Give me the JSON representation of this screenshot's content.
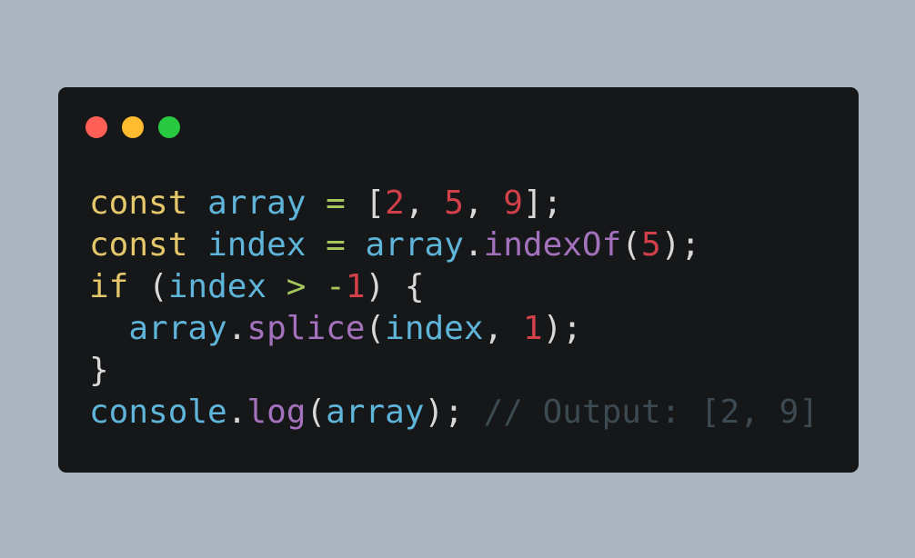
{
  "colors": {
    "background": "#abb5bf",
    "window": "#161719",
    "dot_close": "#ff5f57",
    "dot_minimize": "#febc2e",
    "dot_maximize": "#28c840",
    "keyword": "#e5c76b",
    "identifier": "#5fb4d9",
    "operator": "#a4c55b",
    "number": "#d2404a",
    "function": "#a472bd",
    "punctuation": "#d8d8d8",
    "comment": "#3c4a52"
  },
  "code": {
    "language": "javascript",
    "lines": [
      {
        "name": "line-1",
        "tokens": [
          {
            "t": "const",
            "k": "kw"
          },
          {
            "t": " ",
            "k": "pun"
          },
          {
            "t": "array",
            "k": "var"
          },
          {
            "t": " ",
            "k": "pun"
          },
          {
            "t": "=",
            "k": "op"
          },
          {
            "t": " [",
            "k": "pun"
          },
          {
            "t": "2",
            "k": "num"
          },
          {
            "t": ", ",
            "k": "pun"
          },
          {
            "t": "5",
            "k": "num"
          },
          {
            "t": ", ",
            "k": "pun"
          },
          {
            "t": "9",
            "k": "num"
          },
          {
            "t": "];",
            "k": "pun"
          }
        ]
      },
      {
        "name": "line-2",
        "tokens": [
          {
            "t": "const",
            "k": "kw"
          },
          {
            "t": " ",
            "k": "pun"
          },
          {
            "t": "index",
            "k": "var"
          },
          {
            "t": " ",
            "k": "pun"
          },
          {
            "t": "=",
            "k": "op"
          },
          {
            "t": " ",
            "k": "pun"
          },
          {
            "t": "array",
            "k": "var"
          },
          {
            "t": ".",
            "k": "pun"
          },
          {
            "t": "indexOf",
            "k": "fn"
          },
          {
            "t": "(",
            "k": "pun"
          },
          {
            "t": "5",
            "k": "num"
          },
          {
            "t": ");",
            "k": "pun"
          }
        ]
      },
      {
        "name": "line-3",
        "tokens": [
          {
            "t": "if",
            "k": "kw"
          },
          {
            "t": " (",
            "k": "pun"
          },
          {
            "t": "index",
            "k": "var"
          },
          {
            "t": " ",
            "k": "pun"
          },
          {
            "t": ">",
            "k": "op"
          },
          {
            "t": " ",
            "k": "pun"
          },
          {
            "t": "-",
            "k": "op"
          },
          {
            "t": "1",
            "k": "num"
          },
          {
            "t": ") {",
            "k": "pun"
          }
        ]
      },
      {
        "name": "line-4",
        "tokens": [
          {
            "t": "  ",
            "k": "pun"
          },
          {
            "t": "array",
            "k": "var"
          },
          {
            "t": ".",
            "k": "pun"
          },
          {
            "t": "splice",
            "k": "fn"
          },
          {
            "t": "(",
            "k": "pun"
          },
          {
            "t": "index",
            "k": "var"
          },
          {
            "t": ", ",
            "k": "pun"
          },
          {
            "t": "1",
            "k": "num"
          },
          {
            "t": ");",
            "k": "pun"
          }
        ]
      },
      {
        "name": "line-5",
        "tokens": [
          {
            "t": "}",
            "k": "pun"
          }
        ]
      },
      {
        "name": "line-6",
        "tokens": [
          {
            "t": "console",
            "k": "var"
          },
          {
            "t": ".",
            "k": "pun"
          },
          {
            "t": "log",
            "k": "fn"
          },
          {
            "t": "(",
            "k": "pun"
          },
          {
            "t": "array",
            "k": "var"
          },
          {
            "t": ");",
            "k": "pun"
          },
          {
            "t": " ",
            "k": "pun"
          },
          {
            "t": "// Output: [2, 9]",
            "k": "cmt"
          }
        ]
      }
    ]
  }
}
